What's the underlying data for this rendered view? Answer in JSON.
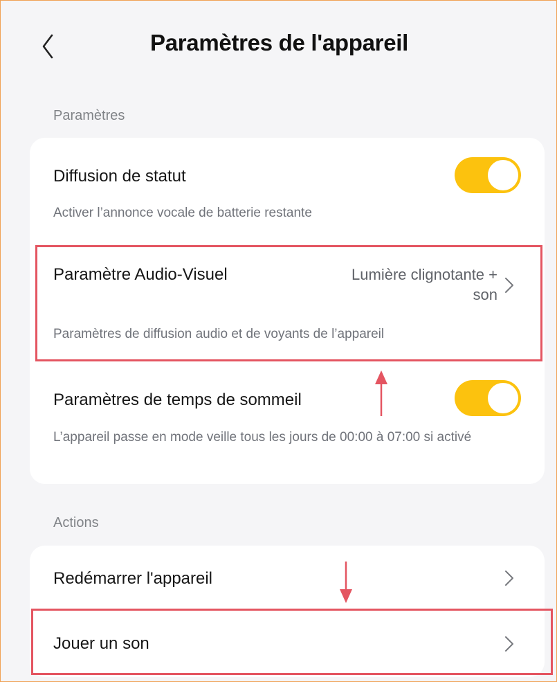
{
  "header": {
    "title": "Paramètres de l'appareil"
  },
  "sections": {
    "settings_label": "Paramètres",
    "actions_label": "Actions"
  },
  "settings": {
    "broadcast": {
      "title": "Diffusion de statut",
      "subtitle": "Activer l’annonce vocale de batterie restante",
      "enabled": true
    },
    "audio_visual": {
      "title": "Paramètre Audio-Visuel",
      "value_line1": "Lumière clignotante +",
      "value_line2": "son",
      "subtitle": "Paramètres de diffusion audio et de voyants de l’appareil"
    },
    "sleep": {
      "title": "Paramètres de temps de sommeil",
      "subtitle": "L’appareil passe en mode veille tous les jours de 00:00 à 07:00 si activé",
      "enabled": true
    }
  },
  "actions": {
    "restart": {
      "title": "Redémarrer l'appareil"
    },
    "play_sound": {
      "title": "Jouer un son"
    }
  },
  "colors": {
    "toggle_on": "#fcc20e",
    "highlight": "#e45561",
    "background": "#f5f5f7",
    "frame_border": "#f0a155"
  },
  "icons": {
    "back": "chevron-left-icon",
    "row_chevron": "chevron-right-icon",
    "annotation_arrow": "red-arrow"
  }
}
